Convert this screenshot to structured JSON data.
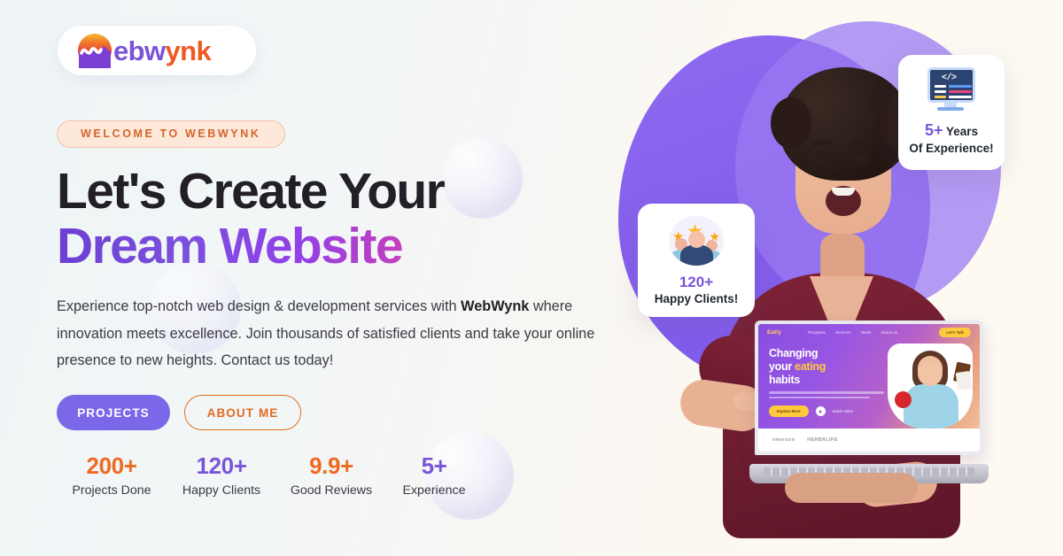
{
  "brand": {
    "logo_icon": "webwynk-wave-logo",
    "name_part1": "ebw",
    "name_part2": "ynk",
    "full_name": "WebWynk",
    "accent_purple": "#7b53d6",
    "accent_orange": "#ef5a24"
  },
  "hero": {
    "badge": "WELCOME TO WEBWYNK",
    "heading_line1": "Let's Create Your",
    "heading_line2": "Dream Website",
    "paragraph_before": "Experience top-notch web design & development services with ",
    "paragraph_bold": "WebWynk",
    "paragraph_after": " where innovation meets excellence. Join thousands of satisfied clients and take your online presence to new heights. Contact us today!"
  },
  "cta": {
    "primary_label": "PROJECTS",
    "secondary_label": "ABOUT ME",
    "primary_color": "#7b68e8",
    "secondary_color": "#e0701f"
  },
  "stats": [
    {
      "num": "200+",
      "label": "Projects Done",
      "color": "#ee6a22"
    },
    {
      "num": "120+",
      "label": "Happy Clients",
      "color": "#7a55d8"
    },
    {
      "num": "9.9+",
      "label": "Good Reviews",
      "color": "#ee6a22"
    },
    {
      "num": "5+",
      "label": "Experience",
      "color": "#7a55d8"
    }
  ],
  "cards": {
    "experience": {
      "icon": "code-monitor-icon",
      "number": "5+",
      "line1_rest": " Years",
      "line2": "Of Experience!"
    },
    "clients": {
      "icon": "three-stars-avatars-icon",
      "number": "120+",
      "label": "Happy Clients!"
    }
  },
  "laptop_mockup": {
    "site_name": "Eatly",
    "nav": [
      "Programs",
      "Services",
      "News",
      "About Us"
    ],
    "nav_cta": "Let's Talk",
    "headline_1": "Changing",
    "headline_2_plain": "your ",
    "headline_2_accent": "eating",
    "headline_3": "habits",
    "btn_primary": "Explore More",
    "btn_video": "Watch Video",
    "partners": [
      "emerson",
      "HERBALIFE"
    ]
  },
  "artwork": {
    "person": "smiling-man-pointing-at-laptop",
    "blob_color": "#8560ec"
  }
}
